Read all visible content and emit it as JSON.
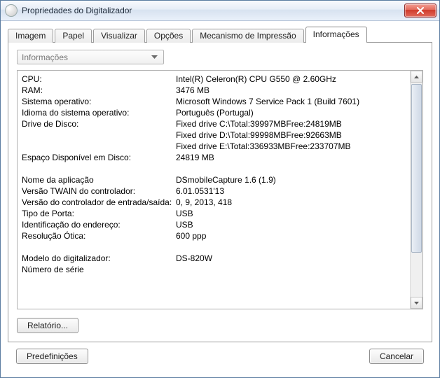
{
  "window": {
    "title": "Propriedades do Digitalizador"
  },
  "tabs": [
    {
      "label": "Imagem"
    },
    {
      "label": "Papel"
    },
    {
      "label": "Visualizar"
    },
    {
      "label": "Opções"
    },
    {
      "label": "Mecanismo de Impressão"
    },
    {
      "label": "Informações"
    }
  ],
  "active_tab_index": 5,
  "dropdown": {
    "selected": "Informações"
  },
  "info": {
    "cpu_label": "CPU:",
    "cpu_value": "Intel(R) Celeron(R) CPU G550 @ 2.60GHz",
    "ram_label": "RAM:",
    "ram_value": "3476 MB",
    "os_label": "Sistema operativo:",
    "os_value": "Microsoft Windows 7 Service Pack 1 (Build 7601)",
    "os_lang_label": "Idioma do sistema operativo:",
    "os_lang_value": "Português (Portugal)",
    "disk_label": "Drive de Disco:",
    "disk_values": [
      "Fixed drive C:\\Total:39997MBFree:24819MB",
      "Fixed drive D:\\Total:99998MBFree:92663MB",
      "Fixed drive E:\\Total:336933MBFree:233707MB"
    ],
    "free_space_label": "Espaço Disponível em Disco:",
    "free_space_value": "24819 MB",
    "app_name_label": "Nome da aplicação",
    "app_name_value": " DSmobileCapture 1.6 (1.9)",
    "twain_label": "Versão TWAIN do controlador:",
    "twain_value": "6.01.0531'13",
    "io_driver_label": "Versão do controlador de entrada/saída:",
    "io_driver_value": "0, 9, 2013, 418",
    "port_type_label": "Tipo de Porta:",
    "port_type_value": "USB",
    "addr_id_label": "Identificação do endereço:",
    "addr_id_value": "USB",
    "optical_res_label": "Resolução Ótica:",
    "optical_res_value": "600 ppp",
    "scanner_model_label": "Modelo do digitalizador:",
    "scanner_model_value": "DS-820W",
    "serial_label": "Número de série"
  },
  "buttons": {
    "report": "Relatório...",
    "defaults": "Predefinições",
    "cancel": "Cancelar"
  }
}
